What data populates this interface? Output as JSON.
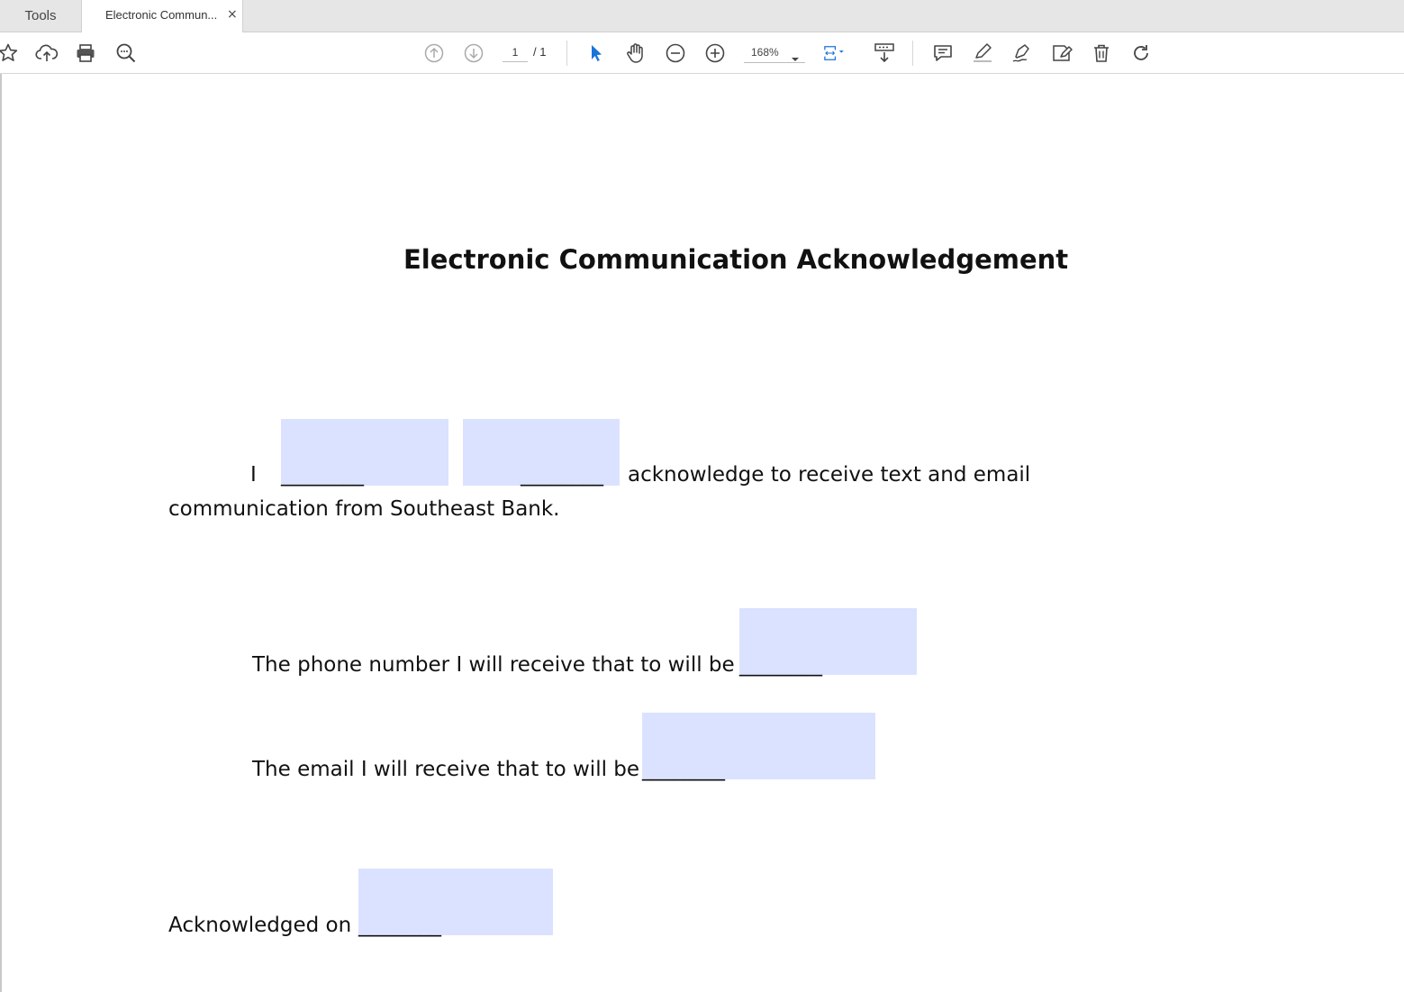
{
  "tabs": {
    "tools_label": "Tools",
    "document_label": "Electronic Commun...",
    "close_glyph": "×"
  },
  "toolbar": {
    "icons": [
      "star-icon",
      "cloud-upload-icon",
      "print-icon",
      "find-icon",
      "previous-page-icon",
      "next-page-icon",
      "select-pointer-icon",
      "hand-tool-icon",
      "zoom-out-icon",
      "zoom-in-icon",
      "fit-page-icon",
      "scroll-mode-icon",
      "comment-icon",
      "highlight-icon",
      "sign-icon",
      "fill-sign-icon",
      "delete-icon",
      "rotate-icon"
    ],
    "page_current": "1",
    "page_total": "/ 1",
    "zoom": "168%",
    "accent_color": "#1a73d9"
  },
  "document": {
    "title": "Electronic Communication Acknowledgement",
    "line1_start": "I",
    "line1_blank_1": "________",
    "line1_blank_2": "________",
    "line1_end": "acknowledge to receive text and email",
    "line2": "communication from Southeast Bank.",
    "phone_text": "The phone number I will receive that to will be",
    "phone_blank": "________",
    "email_text": "The email I will receive that to will be",
    "email_blank": "________",
    "ack_text": "Acknowledged on",
    "ack_blank": "________",
    "field_color": "#dbe2ff",
    "fields": {
      "first_name": "",
      "last_name": "",
      "phone": "",
      "email": "",
      "date": ""
    }
  }
}
